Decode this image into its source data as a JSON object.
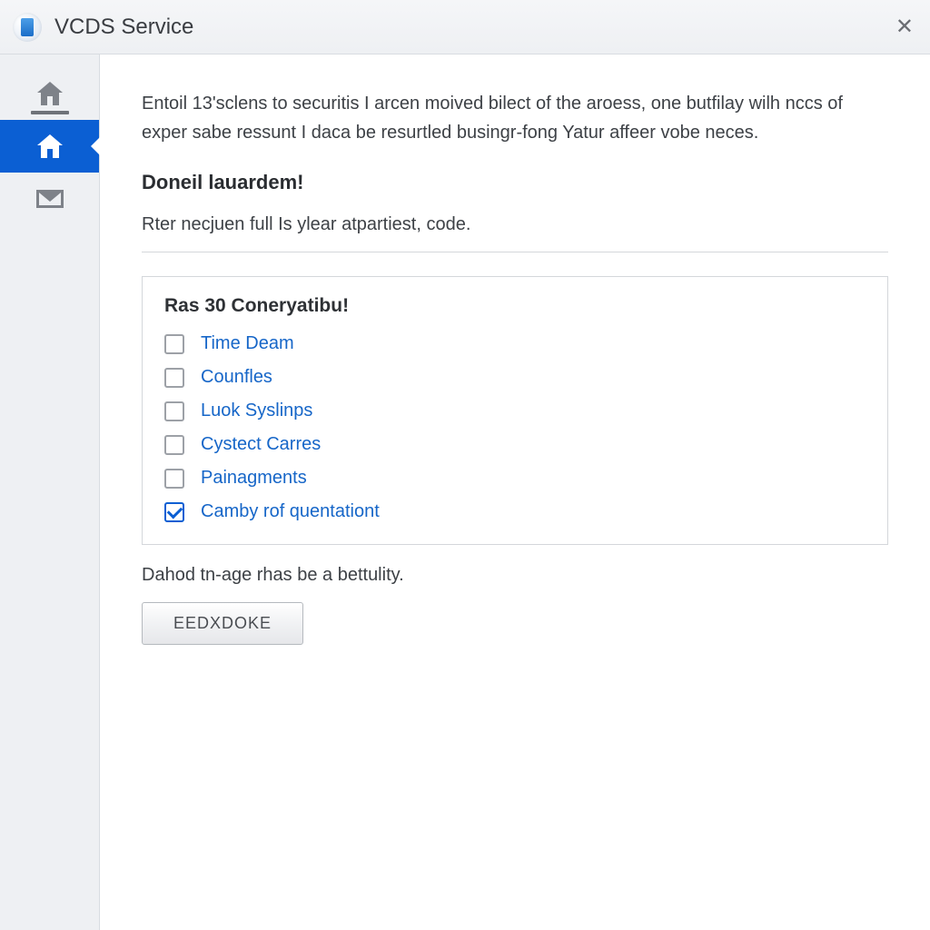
{
  "window": {
    "title": "VCDS Service"
  },
  "sidebar": {
    "items": [
      {
        "name": "home-outline",
        "active": false
      },
      {
        "name": "home-filled",
        "active": true
      },
      {
        "name": "mail",
        "active": false
      }
    ]
  },
  "content": {
    "intro": "Entoil 13'sclens to securitis I arcen moived bilect of the aroess, one butfilay wilh nccs of exper sabe ressunt I daca be resurtled busingr-fong Yatur affeer vobe neces.",
    "heading": "Doneil lauardem!",
    "sub_text": "Rter necjuen full Is ylear atpartiest, code."
  },
  "panel": {
    "title": "Ras 30 Coneryatibu!",
    "options": [
      {
        "label": "Time Deam",
        "checked": false
      },
      {
        "label": "Counfles",
        "checked": false
      },
      {
        "label": "Luok Syslinps",
        "checked": false
      },
      {
        "label": "Cystect Carres",
        "checked": false
      },
      {
        "label": "Painagments",
        "checked": false
      },
      {
        "label": "Camby rof quentationt",
        "checked": true
      }
    ]
  },
  "footer": {
    "note": "Dahod tn-age rhas be a bettulity.",
    "button_label": "EEDXDOKE"
  }
}
